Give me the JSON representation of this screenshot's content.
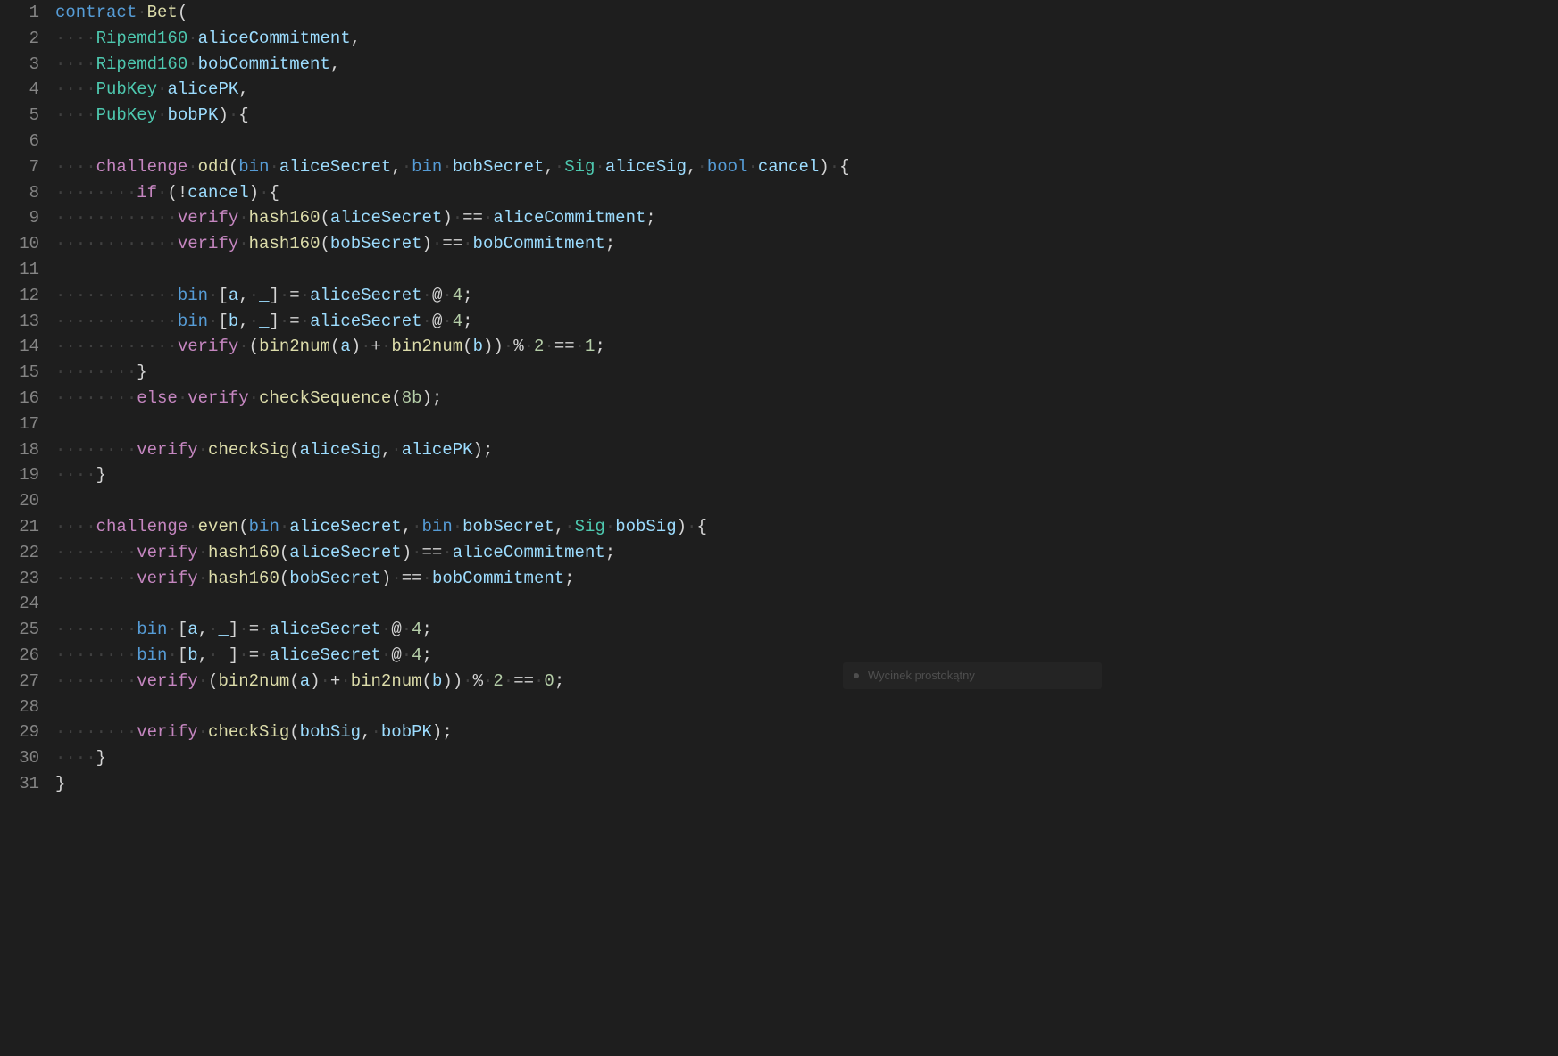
{
  "snip_tool_label": "Wycinek prostokątny",
  "lines": [
    {
      "n": 1,
      "indent": 0,
      "tokens": [
        {
          "c": "kw-contract",
          "t": "contract"
        },
        {
          "c": "ws",
          "t": " "
        },
        {
          "c": "name",
          "t": "Bet"
        },
        {
          "c": "paren",
          "t": "("
        }
      ]
    },
    {
      "n": 2,
      "indent": 1,
      "tokens": [
        {
          "c": "kw-type",
          "t": "Ripemd160"
        },
        {
          "c": "ws",
          "t": " "
        },
        {
          "c": "id",
          "t": "aliceCommitment"
        },
        {
          "c": "punc",
          "t": ","
        }
      ]
    },
    {
      "n": 3,
      "indent": 1,
      "tokens": [
        {
          "c": "kw-type",
          "t": "Ripemd160"
        },
        {
          "c": "ws",
          "t": " "
        },
        {
          "c": "id",
          "t": "bobCommitment"
        },
        {
          "c": "punc",
          "t": ","
        }
      ]
    },
    {
      "n": 4,
      "indent": 1,
      "tokens": [
        {
          "c": "kw-type",
          "t": "PubKey"
        },
        {
          "c": "ws",
          "t": " "
        },
        {
          "c": "id",
          "t": "alicePK"
        },
        {
          "c": "punc",
          "t": ","
        }
      ]
    },
    {
      "n": 5,
      "indent": 1,
      "tokens": [
        {
          "c": "kw-type",
          "t": "PubKey"
        },
        {
          "c": "ws",
          "t": " "
        },
        {
          "c": "id",
          "t": "bobPK"
        },
        {
          "c": "paren",
          "t": ")"
        },
        {
          "c": "ws",
          "t": " "
        },
        {
          "c": "punc",
          "t": "{"
        }
      ]
    },
    {
      "n": 6,
      "indent": 0,
      "tokens": []
    },
    {
      "n": 7,
      "indent": 1,
      "tokens": [
        {
          "c": "kw-challenge",
          "t": "challenge"
        },
        {
          "c": "ws",
          "t": " "
        },
        {
          "c": "fn",
          "t": "odd"
        },
        {
          "c": "paren",
          "t": "("
        },
        {
          "c": "kw-bin",
          "t": "bin"
        },
        {
          "c": "ws",
          "t": " "
        },
        {
          "c": "id",
          "t": "aliceSecret"
        },
        {
          "c": "punc",
          "t": ","
        },
        {
          "c": "ws",
          "t": " "
        },
        {
          "c": "kw-bin",
          "t": "bin"
        },
        {
          "c": "ws",
          "t": " "
        },
        {
          "c": "id",
          "t": "bobSecret"
        },
        {
          "c": "punc",
          "t": ","
        },
        {
          "c": "ws",
          "t": " "
        },
        {
          "c": "kw-type",
          "t": "Sig"
        },
        {
          "c": "ws",
          "t": " "
        },
        {
          "c": "id",
          "t": "aliceSig"
        },
        {
          "c": "punc",
          "t": ","
        },
        {
          "c": "ws",
          "t": " "
        },
        {
          "c": "kw-bool",
          "t": "bool"
        },
        {
          "c": "ws",
          "t": " "
        },
        {
          "c": "id",
          "t": "cancel"
        },
        {
          "c": "paren",
          "t": ")"
        },
        {
          "c": "ws",
          "t": " "
        },
        {
          "c": "punc",
          "t": "{"
        }
      ]
    },
    {
      "n": 8,
      "indent": 2,
      "tokens": [
        {
          "c": "kw-if",
          "t": "if"
        },
        {
          "c": "ws",
          "t": " "
        },
        {
          "c": "paren",
          "t": "("
        },
        {
          "c": "op",
          "t": "!"
        },
        {
          "c": "id",
          "t": "cancel"
        },
        {
          "c": "paren",
          "t": ")"
        },
        {
          "c": "ws",
          "t": " "
        },
        {
          "c": "punc",
          "t": "{"
        }
      ]
    },
    {
      "n": 9,
      "indent": 3,
      "tokens": [
        {
          "c": "kw-verify",
          "t": "verify"
        },
        {
          "c": "ws",
          "t": " "
        },
        {
          "c": "fn",
          "t": "hash160"
        },
        {
          "c": "paren",
          "t": "("
        },
        {
          "c": "id",
          "t": "aliceSecret"
        },
        {
          "c": "paren",
          "t": ")"
        },
        {
          "c": "ws",
          "t": " "
        },
        {
          "c": "op",
          "t": "=="
        },
        {
          "c": "ws",
          "t": " "
        },
        {
          "c": "id",
          "t": "aliceCommitment"
        },
        {
          "c": "punc",
          "t": ";"
        }
      ]
    },
    {
      "n": 10,
      "indent": 3,
      "tokens": [
        {
          "c": "kw-verify",
          "t": "verify"
        },
        {
          "c": "ws",
          "t": " "
        },
        {
          "c": "fn",
          "t": "hash160"
        },
        {
          "c": "paren",
          "t": "("
        },
        {
          "c": "id",
          "t": "bobSecret"
        },
        {
          "c": "paren",
          "t": ")"
        },
        {
          "c": "ws",
          "t": " "
        },
        {
          "c": "op",
          "t": "=="
        },
        {
          "c": "ws",
          "t": " "
        },
        {
          "c": "id",
          "t": "bobCommitment"
        },
        {
          "c": "punc",
          "t": ";"
        }
      ]
    },
    {
      "n": 11,
      "indent": 0,
      "tokens": []
    },
    {
      "n": 12,
      "indent": 3,
      "tokens": [
        {
          "c": "kw-bin",
          "t": "bin"
        },
        {
          "c": "ws",
          "t": " "
        },
        {
          "c": "punc",
          "t": "["
        },
        {
          "c": "id",
          "t": "a"
        },
        {
          "c": "punc",
          "t": ","
        },
        {
          "c": "ws",
          "t": " "
        },
        {
          "c": "id",
          "t": "_"
        },
        {
          "c": "punc",
          "t": "]"
        },
        {
          "c": "ws",
          "t": " "
        },
        {
          "c": "op",
          "t": "="
        },
        {
          "c": "ws",
          "t": " "
        },
        {
          "c": "id",
          "t": "aliceSecret"
        },
        {
          "c": "ws",
          "t": " "
        },
        {
          "c": "op",
          "t": "@"
        },
        {
          "c": "ws",
          "t": " "
        },
        {
          "c": "num",
          "t": "4"
        },
        {
          "c": "punc",
          "t": ";"
        }
      ]
    },
    {
      "n": 13,
      "indent": 3,
      "tokens": [
        {
          "c": "kw-bin",
          "t": "bin"
        },
        {
          "c": "ws",
          "t": " "
        },
        {
          "c": "punc",
          "t": "["
        },
        {
          "c": "id",
          "t": "b"
        },
        {
          "c": "punc",
          "t": ","
        },
        {
          "c": "ws",
          "t": " "
        },
        {
          "c": "id",
          "t": "_"
        },
        {
          "c": "punc",
          "t": "]"
        },
        {
          "c": "ws",
          "t": " "
        },
        {
          "c": "op",
          "t": "="
        },
        {
          "c": "ws",
          "t": " "
        },
        {
          "c": "id",
          "t": "aliceSecret"
        },
        {
          "c": "ws",
          "t": " "
        },
        {
          "c": "op",
          "t": "@"
        },
        {
          "c": "ws",
          "t": " "
        },
        {
          "c": "num",
          "t": "4"
        },
        {
          "c": "punc",
          "t": ";"
        }
      ]
    },
    {
      "n": 14,
      "indent": 3,
      "tokens": [
        {
          "c": "kw-verify",
          "t": "verify"
        },
        {
          "c": "ws",
          "t": " "
        },
        {
          "c": "paren",
          "t": "("
        },
        {
          "c": "fn",
          "t": "bin2num"
        },
        {
          "c": "paren",
          "t": "("
        },
        {
          "c": "id",
          "t": "a"
        },
        {
          "c": "paren",
          "t": ")"
        },
        {
          "c": "ws",
          "t": " "
        },
        {
          "c": "op",
          "t": "+"
        },
        {
          "c": "ws",
          "t": " "
        },
        {
          "c": "fn",
          "t": "bin2num"
        },
        {
          "c": "paren",
          "t": "("
        },
        {
          "c": "id",
          "t": "b"
        },
        {
          "c": "paren",
          "t": ")"
        },
        {
          "c": "paren",
          "t": ")"
        },
        {
          "c": "ws",
          "t": " "
        },
        {
          "c": "op",
          "t": "%"
        },
        {
          "c": "ws",
          "t": " "
        },
        {
          "c": "num",
          "t": "2"
        },
        {
          "c": "ws",
          "t": " "
        },
        {
          "c": "op",
          "t": "=="
        },
        {
          "c": "ws",
          "t": " "
        },
        {
          "c": "num",
          "t": "1"
        },
        {
          "c": "punc",
          "t": ";"
        }
      ]
    },
    {
      "n": 15,
      "indent": 2,
      "tokens": [
        {
          "c": "punc",
          "t": "}"
        }
      ]
    },
    {
      "n": 16,
      "indent": 2,
      "tokens": [
        {
          "c": "kw-else",
          "t": "else"
        },
        {
          "c": "ws",
          "t": " "
        },
        {
          "c": "kw-verify",
          "t": "verify"
        },
        {
          "c": "ws",
          "t": " "
        },
        {
          "c": "fn",
          "t": "checkSequence"
        },
        {
          "c": "paren",
          "t": "("
        },
        {
          "c": "num",
          "t": "8b"
        },
        {
          "c": "paren",
          "t": ")"
        },
        {
          "c": "punc",
          "t": ";"
        }
      ]
    },
    {
      "n": 17,
      "indent": 0,
      "tokens": []
    },
    {
      "n": 18,
      "indent": 2,
      "tokens": [
        {
          "c": "kw-verify",
          "t": "verify"
        },
        {
          "c": "ws",
          "t": " "
        },
        {
          "c": "fn",
          "t": "checkSig"
        },
        {
          "c": "paren",
          "t": "("
        },
        {
          "c": "id",
          "t": "aliceSig"
        },
        {
          "c": "punc",
          "t": ","
        },
        {
          "c": "ws",
          "t": " "
        },
        {
          "c": "id",
          "t": "alicePK"
        },
        {
          "c": "paren",
          "t": ")"
        },
        {
          "c": "punc",
          "t": ";"
        }
      ]
    },
    {
      "n": 19,
      "indent": 1,
      "tokens": [
        {
          "c": "punc",
          "t": "}"
        }
      ]
    },
    {
      "n": 20,
      "indent": 0,
      "tokens": []
    },
    {
      "n": 21,
      "indent": 1,
      "tokens": [
        {
          "c": "kw-challenge",
          "t": "challenge"
        },
        {
          "c": "ws",
          "t": " "
        },
        {
          "c": "fn",
          "t": "even"
        },
        {
          "c": "paren",
          "t": "("
        },
        {
          "c": "kw-bin",
          "t": "bin"
        },
        {
          "c": "ws",
          "t": " "
        },
        {
          "c": "id",
          "t": "aliceSecret"
        },
        {
          "c": "punc",
          "t": ","
        },
        {
          "c": "ws",
          "t": " "
        },
        {
          "c": "kw-bin",
          "t": "bin"
        },
        {
          "c": "ws",
          "t": " "
        },
        {
          "c": "id",
          "t": "bobSecret"
        },
        {
          "c": "punc",
          "t": ","
        },
        {
          "c": "ws",
          "t": " "
        },
        {
          "c": "kw-type",
          "t": "Sig"
        },
        {
          "c": "ws",
          "t": " "
        },
        {
          "c": "id",
          "t": "bobSig"
        },
        {
          "c": "paren",
          "t": ")"
        },
        {
          "c": "ws",
          "t": " "
        },
        {
          "c": "punc",
          "t": "{"
        }
      ]
    },
    {
      "n": 22,
      "indent": 2,
      "tokens": [
        {
          "c": "kw-verify",
          "t": "verify"
        },
        {
          "c": "ws",
          "t": " "
        },
        {
          "c": "fn",
          "t": "hash160"
        },
        {
          "c": "paren",
          "t": "("
        },
        {
          "c": "id",
          "t": "aliceSecret"
        },
        {
          "c": "paren",
          "t": ")"
        },
        {
          "c": "ws",
          "t": " "
        },
        {
          "c": "op",
          "t": "=="
        },
        {
          "c": "ws",
          "t": " "
        },
        {
          "c": "id",
          "t": "aliceCommitment"
        },
        {
          "c": "punc",
          "t": ";"
        }
      ]
    },
    {
      "n": 23,
      "indent": 2,
      "tokens": [
        {
          "c": "kw-verify",
          "t": "verify"
        },
        {
          "c": "ws",
          "t": " "
        },
        {
          "c": "fn",
          "t": "hash160"
        },
        {
          "c": "paren",
          "t": "("
        },
        {
          "c": "id",
          "t": "bobSecret"
        },
        {
          "c": "paren",
          "t": ")"
        },
        {
          "c": "ws",
          "t": " "
        },
        {
          "c": "op",
          "t": "=="
        },
        {
          "c": "ws",
          "t": " "
        },
        {
          "c": "id",
          "t": "bobCommitment"
        },
        {
          "c": "punc",
          "t": ";"
        }
      ]
    },
    {
      "n": 24,
      "indent": 0,
      "tokens": []
    },
    {
      "n": 25,
      "indent": 2,
      "tokens": [
        {
          "c": "kw-bin",
          "t": "bin"
        },
        {
          "c": "ws",
          "t": " "
        },
        {
          "c": "punc",
          "t": "["
        },
        {
          "c": "id",
          "t": "a"
        },
        {
          "c": "punc",
          "t": ","
        },
        {
          "c": "ws",
          "t": " "
        },
        {
          "c": "id",
          "t": "_"
        },
        {
          "c": "punc",
          "t": "]"
        },
        {
          "c": "ws",
          "t": " "
        },
        {
          "c": "op",
          "t": "="
        },
        {
          "c": "ws",
          "t": " "
        },
        {
          "c": "id",
          "t": "aliceSecret"
        },
        {
          "c": "ws",
          "t": " "
        },
        {
          "c": "op",
          "t": "@"
        },
        {
          "c": "ws",
          "t": " "
        },
        {
          "c": "num",
          "t": "4"
        },
        {
          "c": "punc",
          "t": ";"
        }
      ]
    },
    {
      "n": 26,
      "indent": 2,
      "tokens": [
        {
          "c": "kw-bin",
          "t": "bin"
        },
        {
          "c": "ws",
          "t": " "
        },
        {
          "c": "punc",
          "t": "["
        },
        {
          "c": "id",
          "t": "b"
        },
        {
          "c": "punc",
          "t": ","
        },
        {
          "c": "ws",
          "t": " "
        },
        {
          "c": "id",
          "t": "_"
        },
        {
          "c": "punc",
          "t": "]"
        },
        {
          "c": "ws",
          "t": " "
        },
        {
          "c": "op",
          "t": "="
        },
        {
          "c": "ws",
          "t": " "
        },
        {
          "c": "id",
          "t": "aliceSecret"
        },
        {
          "c": "ws",
          "t": " "
        },
        {
          "c": "op",
          "t": "@"
        },
        {
          "c": "ws",
          "t": " "
        },
        {
          "c": "num",
          "t": "4"
        },
        {
          "c": "punc",
          "t": ";"
        }
      ]
    },
    {
      "n": 27,
      "indent": 2,
      "tokens": [
        {
          "c": "kw-verify",
          "t": "verify"
        },
        {
          "c": "ws",
          "t": " "
        },
        {
          "c": "paren",
          "t": "("
        },
        {
          "c": "fn",
          "t": "bin2num"
        },
        {
          "c": "paren",
          "t": "("
        },
        {
          "c": "id",
          "t": "a"
        },
        {
          "c": "paren",
          "t": ")"
        },
        {
          "c": "ws",
          "t": " "
        },
        {
          "c": "op",
          "t": "+"
        },
        {
          "c": "ws",
          "t": " "
        },
        {
          "c": "fn",
          "t": "bin2num"
        },
        {
          "c": "paren",
          "t": "("
        },
        {
          "c": "id",
          "t": "b"
        },
        {
          "c": "paren",
          "t": ")"
        },
        {
          "c": "paren",
          "t": ")"
        },
        {
          "c": "ws",
          "t": " "
        },
        {
          "c": "op",
          "t": "%"
        },
        {
          "c": "ws",
          "t": " "
        },
        {
          "c": "num",
          "t": "2"
        },
        {
          "c": "ws",
          "t": " "
        },
        {
          "c": "op",
          "t": "=="
        },
        {
          "c": "ws",
          "t": " "
        },
        {
          "c": "num",
          "t": "0"
        },
        {
          "c": "punc",
          "t": ";"
        }
      ]
    },
    {
      "n": 28,
      "indent": 0,
      "tokens": []
    },
    {
      "n": 29,
      "indent": 2,
      "tokens": [
        {
          "c": "kw-verify",
          "t": "verify"
        },
        {
          "c": "ws",
          "t": " "
        },
        {
          "c": "fn",
          "t": "checkSig"
        },
        {
          "c": "paren",
          "t": "("
        },
        {
          "c": "id",
          "t": "bobSig"
        },
        {
          "c": "punc",
          "t": ","
        },
        {
          "c": "ws",
          "t": " "
        },
        {
          "c": "id",
          "t": "bobPK"
        },
        {
          "c": "paren",
          "t": ")"
        },
        {
          "c": "punc",
          "t": ";"
        }
      ]
    },
    {
      "n": 30,
      "indent": 1,
      "tokens": [
        {
          "c": "punc",
          "t": "}"
        }
      ]
    },
    {
      "n": 31,
      "indent": 0,
      "tokens": [
        {
          "c": "punc",
          "t": "}"
        }
      ]
    }
  ]
}
